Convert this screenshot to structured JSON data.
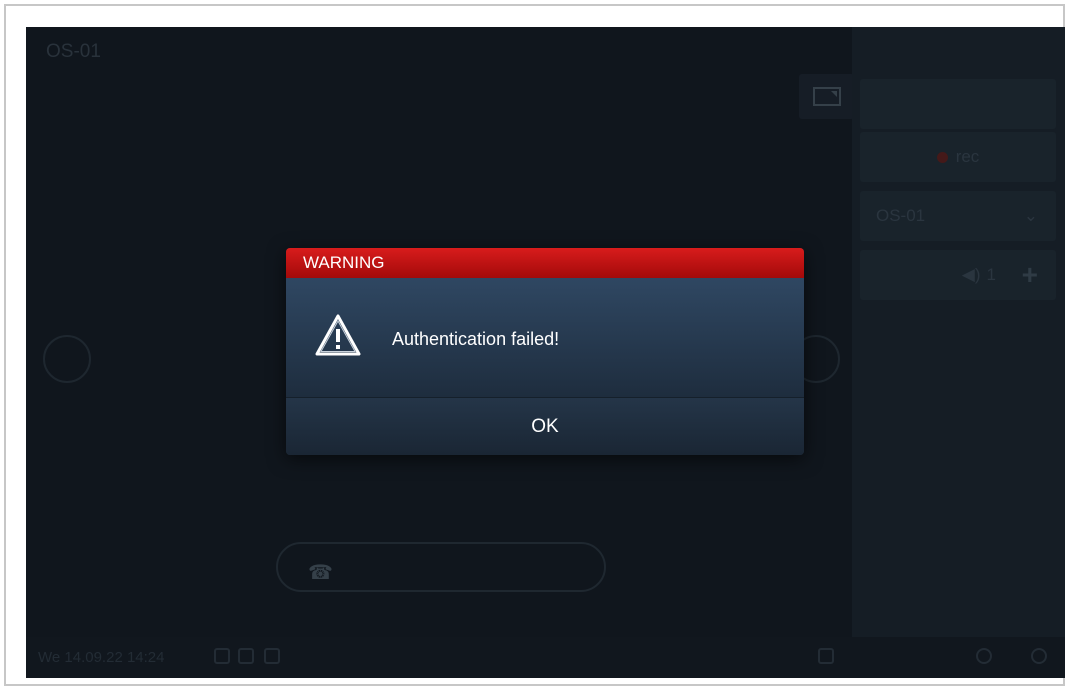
{
  "background": {
    "device_title": "OS-01",
    "side_panel": {
      "rec_label": "rec",
      "station_select": "OS-01",
      "volume_value": "1"
    },
    "status_bar": {
      "datetime": "We 14.09.22 14:24"
    }
  },
  "dialog": {
    "title": "WARNING",
    "message": "Authentication failed!",
    "ok_label": "OK",
    "header_color": "#c41212",
    "icon": "warning-triangle-icon"
  }
}
